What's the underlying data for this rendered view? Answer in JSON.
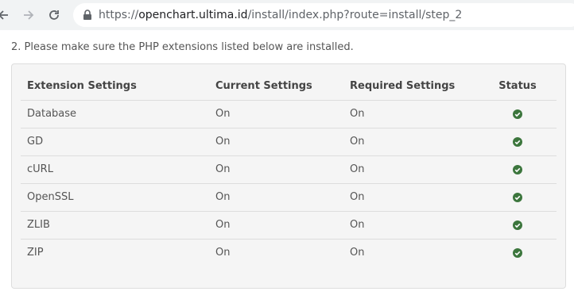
{
  "browser": {
    "back_icon": "arrow-left-icon",
    "forward_icon": "arrow-right-icon",
    "reload_icon": "reload-icon",
    "lock_icon": "lock-icon",
    "url_scheme": "https://",
    "url_host": "openchart.ultima.id",
    "url_path": "/install/index.php?route=install/step_2"
  },
  "page": {
    "instruction": "2. Please make sure the PHP extensions listed below are installed."
  },
  "table": {
    "headers": [
      "Extension Settings",
      "Current Settings",
      "Required Settings",
      "Status"
    ],
    "rows": [
      {
        "extension": "Database",
        "current": "On",
        "required": "On",
        "status_icon": "check-circle-icon"
      },
      {
        "extension": "GD",
        "current": "On",
        "required": "On",
        "status_icon": "check-circle-icon"
      },
      {
        "extension": "cURL",
        "current": "On",
        "required": "On",
        "status_icon": "check-circle-icon"
      },
      {
        "extension": "OpenSSL",
        "current": "On",
        "required": "On",
        "status_icon": "check-circle-icon"
      },
      {
        "extension": "ZLIB",
        "current": "On",
        "required": "On",
        "status_icon": "check-circle-icon"
      },
      {
        "extension": "ZIP",
        "current": "On",
        "required": "On",
        "status_icon": "check-circle-icon"
      }
    ]
  },
  "colors": {
    "status_ok": "#3c763d"
  }
}
